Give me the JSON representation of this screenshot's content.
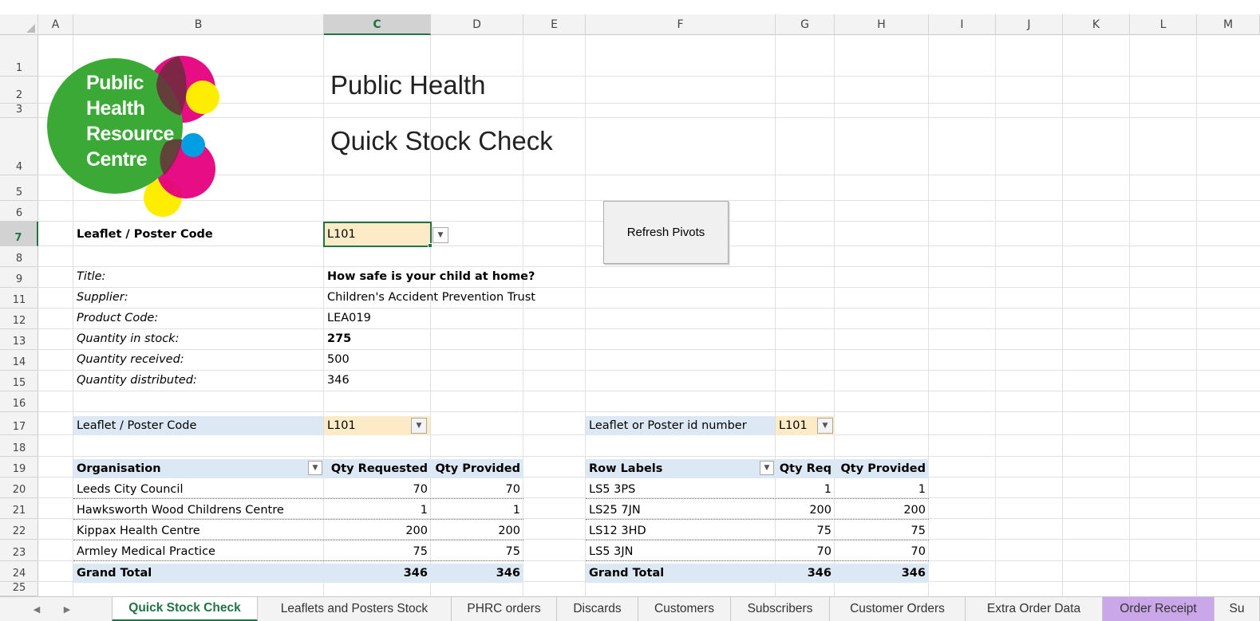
{
  "columns": [
    "A",
    "B",
    "C",
    "D",
    "E",
    "F",
    "G",
    "H",
    "I",
    "J",
    "K",
    "L",
    "M"
  ],
  "rows": [
    "1",
    "2",
    "3",
    "4",
    "5",
    "6",
    "7",
    "8",
    "9",
    "11",
    "12",
    "13",
    "14",
    "15",
    "16",
    "17",
    "18",
    "19",
    "20",
    "21",
    "22",
    "23",
    "24",
    "25"
  ],
  "active_cell": {
    "column": "C",
    "row": "7"
  },
  "logo": {
    "line1": "Public",
    "line2": "Health",
    "line3": "Resource",
    "line4": "Centre",
    "colors": {
      "green": "#3aa935",
      "pink": "#e5007e",
      "yellow": "#ffed00",
      "blue": "#009fe3"
    }
  },
  "header": {
    "title": "Public Health",
    "subtitle": "Quick Stock Check"
  },
  "selector": {
    "label": "Leaflet / Poster Code",
    "value": "L101"
  },
  "refresh_button": "Refresh Pivots",
  "details": [
    {
      "label": "Title:",
      "value": "How safe is your child at home?",
      "bold": true
    },
    {
      "label": "Supplier:",
      "value": "Children's Accident Prevention Trust",
      "bold": false
    },
    {
      "label": "Product Code:",
      "value": "LEA019",
      "bold": false
    },
    {
      "label": "Quantity in stock:",
      "value": "275",
      "bold": true
    },
    {
      "label": "Quantity received:",
      "value": "500",
      "bold": false
    },
    {
      "label": "Quantity distributed:",
      "value": "346",
      "bold": false
    }
  ],
  "pivot1": {
    "filter_label": "Leaflet / Poster Code",
    "filter_value": "L101",
    "headers": [
      "Organisation",
      "Qty Requested",
      "Qty Provided"
    ],
    "rows": [
      [
        "Leeds City Council",
        "70",
        "70"
      ],
      [
        "Hawksworth Wood Childrens Centre",
        "1",
        "1"
      ],
      [
        "Kippax Health Centre",
        "200",
        "200"
      ],
      [
        "Armley Medical Practice",
        "75",
        "75"
      ]
    ],
    "total": [
      "Grand Total",
      "346",
      "346"
    ]
  },
  "pivot2": {
    "filter_label": "Leaflet or Poster id number",
    "filter_value": "L101",
    "headers": [
      "Row Labels",
      "Qty Req",
      "Qty Provided"
    ],
    "rows": [
      [
        "LS5 3PS",
        "1",
        "1"
      ],
      [
        "LS25 7JN",
        "200",
        "200"
      ],
      [
        "LS12 3HD",
        "75",
        "75"
      ],
      [
        "LS5 3JN",
        "70",
        "70"
      ]
    ],
    "total": [
      "Grand Total",
      "346",
      "346"
    ]
  },
  "tabs": [
    {
      "label": "Quick Stock Check",
      "active": true
    },
    {
      "label": "Leaflets and Posters Stock"
    },
    {
      "label": "PHRC orders"
    },
    {
      "label": "Discards"
    },
    {
      "label": "Customers"
    },
    {
      "label": "Subscribers"
    },
    {
      "label": "Customer Orders"
    },
    {
      "label": "Extra Order Data"
    },
    {
      "label": "Order Receipt",
      "color": "#c9a7e8"
    },
    {
      "label": "Su"
    }
  ]
}
